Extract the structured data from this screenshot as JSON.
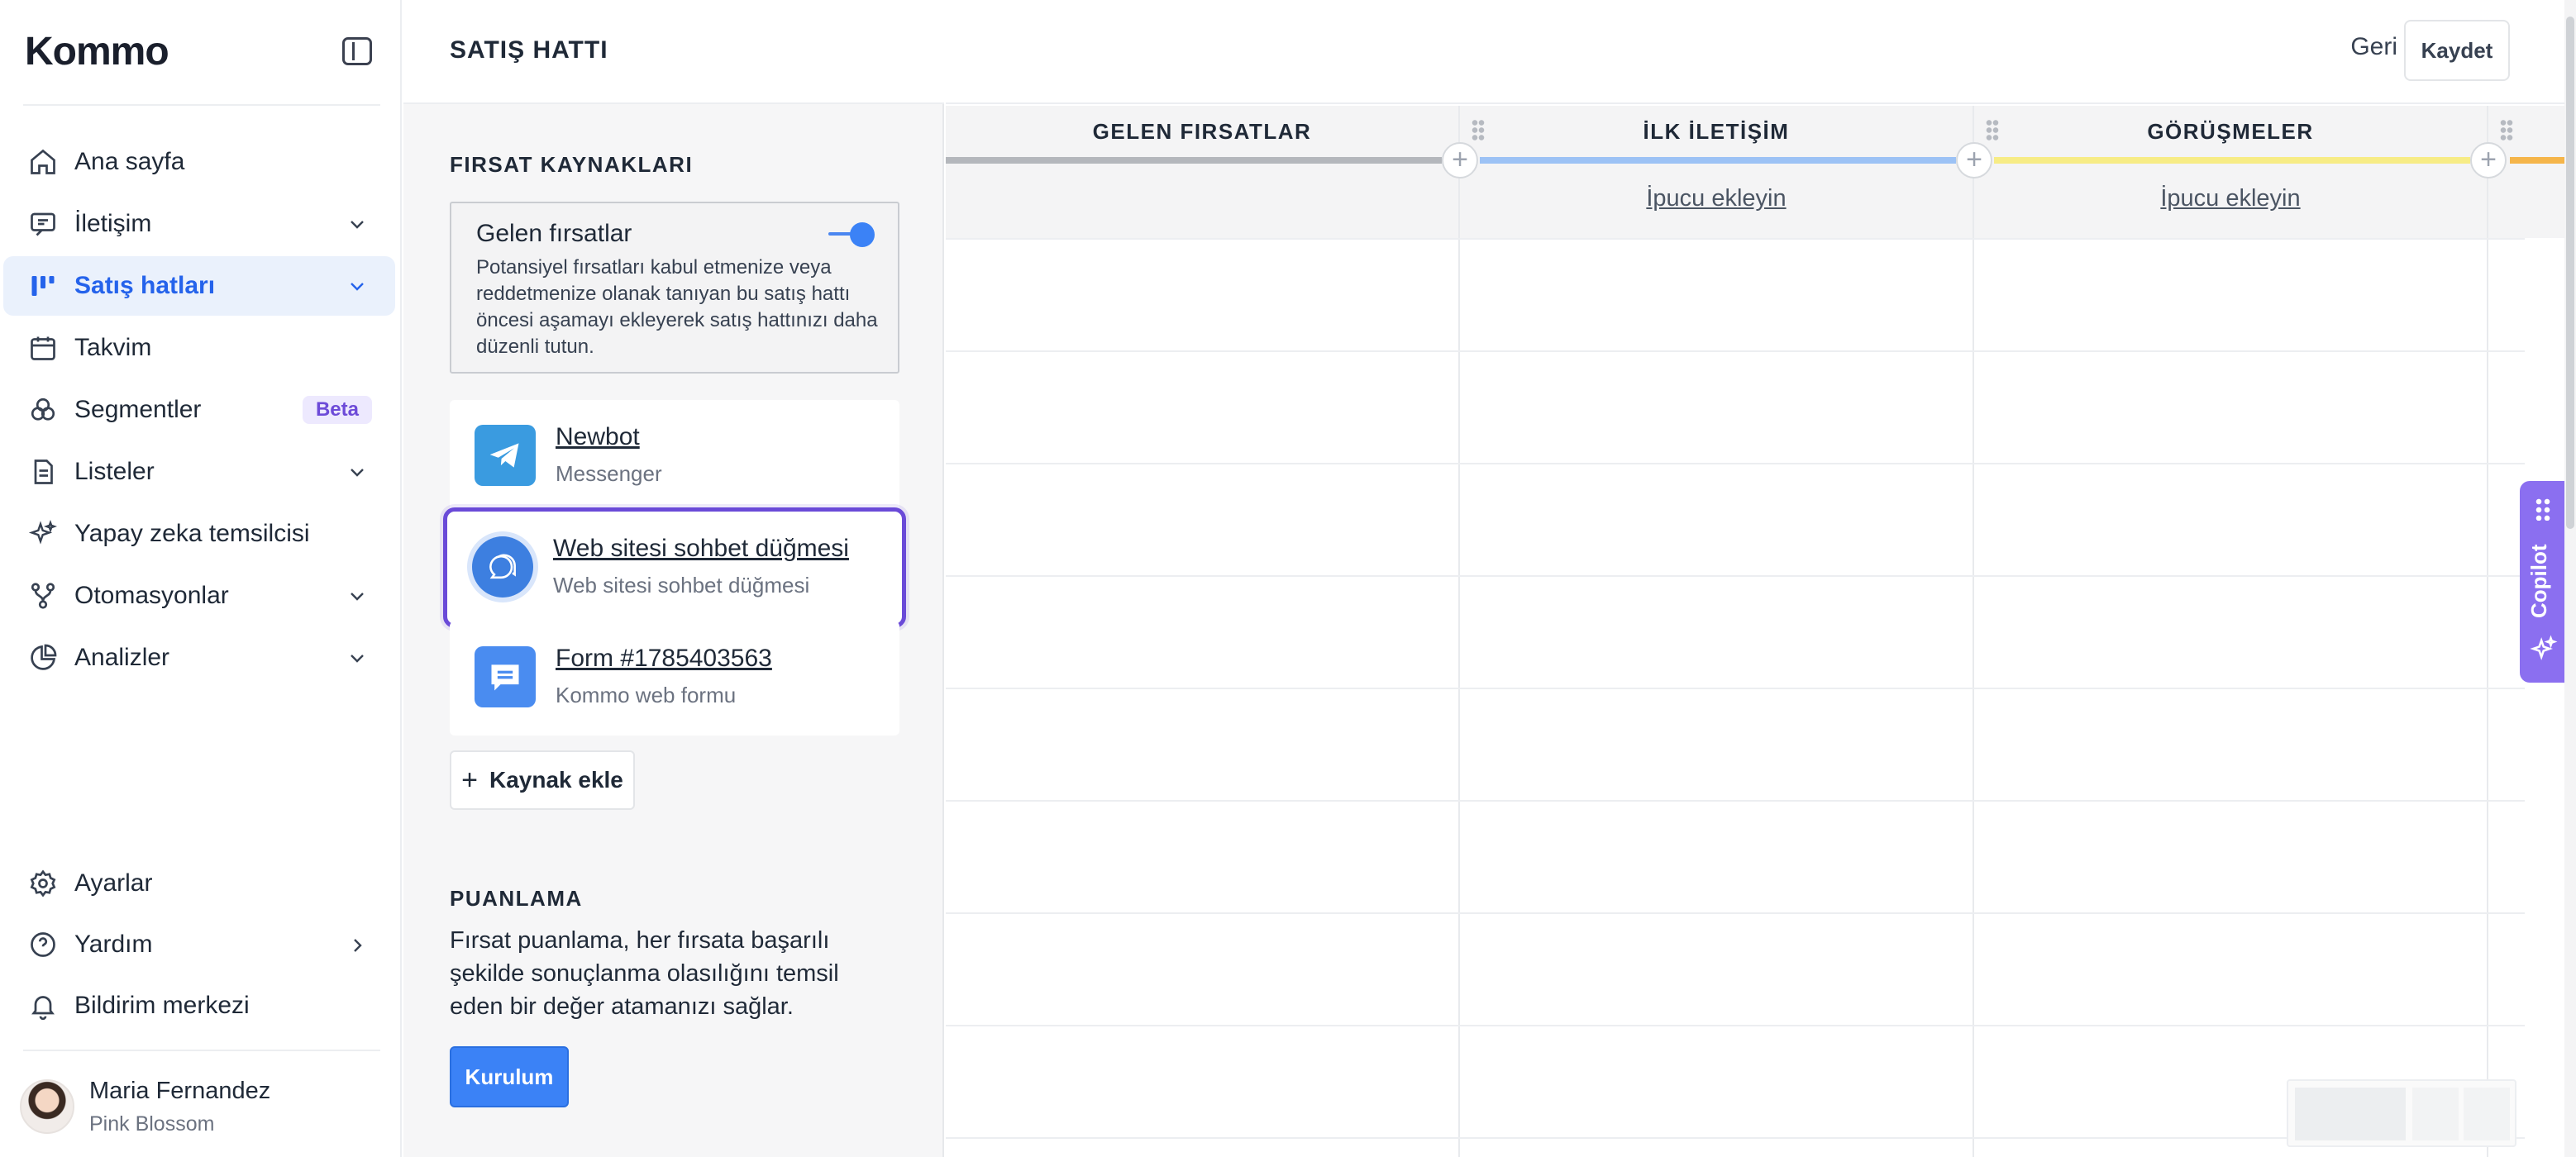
{
  "app": {
    "logo_text": "Kommo"
  },
  "sidebar": {
    "items": [
      {
        "label": "Ana sayfa",
        "icon": "home-icon",
        "has_chevron": false
      },
      {
        "label": "İletişim",
        "icon": "chat-icon",
        "has_chevron": true
      },
      {
        "label": "Satış hatları",
        "icon": "pipeline-icon",
        "has_chevron": true,
        "active": true
      },
      {
        "label": "Takvim",
        "icon": "calendar-icon",
        "has_chevron": false
      },
      {
        "label": "Segmentler",
        "icon": "segments-icon",
        "has_chevron": false,
        "badge": "Beta"
      },
      {
        "label": "Listeler",
        "icon": "list-icon",
        "has_chevron": true
      },
      {
        "label": "Yapay zeka temsilcisi",
        "icon": "sparkle-icon",
        "has_chevron": false
      },
      {
        "label": "Otomasyonlar",
        "icon": "automation-icon",
        "has_chevron": true
      },
      {
        "label": "Analizler",
        "icon": "analytics-icon",
        "has_chevron": true
      }
    ],
    "bottom_items": [
      {
        "label": "Ayarlar",
        "icon": "gear-icon"
      },
      {
        "label": "Yardım",
        "icon": "help-icon"
      },
      {
        "label": "Bildirim merkezi",
        "icon": "bell-icon"
      }
    ],
    "user": {
      "name": "Maria Fernandez",
      "company": "Pink Blossom"
    }
  },
  "panel": {
    "title": "SATIŞ HATTI",
    "sources_title": "FIRSAT KAYNAKLARI",
    "incoming": {
      "title": "Gelen fırsatlar",
      "description": "Potansiyel fırsatları kabul etmenize veya reddetmenize olanak tanıyan bu satış hattı öncesi aşamayı ekleyerek satış hattınızı daha düzenli tutun.",
      "enabled": true
    },
    "sources": [
      {
        "name": "Newbot",
        "type": "Messenger",
        "icon": "telegram-icon"
      },
      {
        "name": "Web sitesi sohbet düğmesi",
        "type": "Web sitesi sohbet düğmesi",
        "icon": "chat-bubble-icon",
        "selected": true
      },
      {
        "name": "Form #1785403563",
        "type": "Kommo web formu",
        "icon": "form-icon"
      }
    ],
    "add_source_label": "Kaynak ekle",
    "scoring_title": "PUANLAMA",
    "scoring_description": "Fırsat puanlama, her fırsata başarılı şekilde sonuçlanma olasılığını temsil eden bir değer atamanızı sağlar.",
    "setup_label": "Kurulum"
  },
  "board": {
    "back_label": "Geri",
    "save_label": "Kaydet",
    "columns": [
      {
        "title": "GELEN FIRSATLAR",
        "color": "#b4b7bc",
        "add_label": ""
      },
      {
        "title": "İLK İLETİŞİM",
        "color": "#9cc2f5",
        "add_label": "İpucu ekleyin"
      },
      {
        "title": "GÖRÜŞMELER",
        "color": "#f7ec86",
        "add_label": "İpucu ekleyin"
      }
    ],
    "copilot_label": "Copilot"
  },
  "colors": {
    "accent": "#3b82f6",
    "selection": "#6a4ad8",
    "copilot": "#8b6ff0",
    "next_stage": "#f5b54a"
  }
}
